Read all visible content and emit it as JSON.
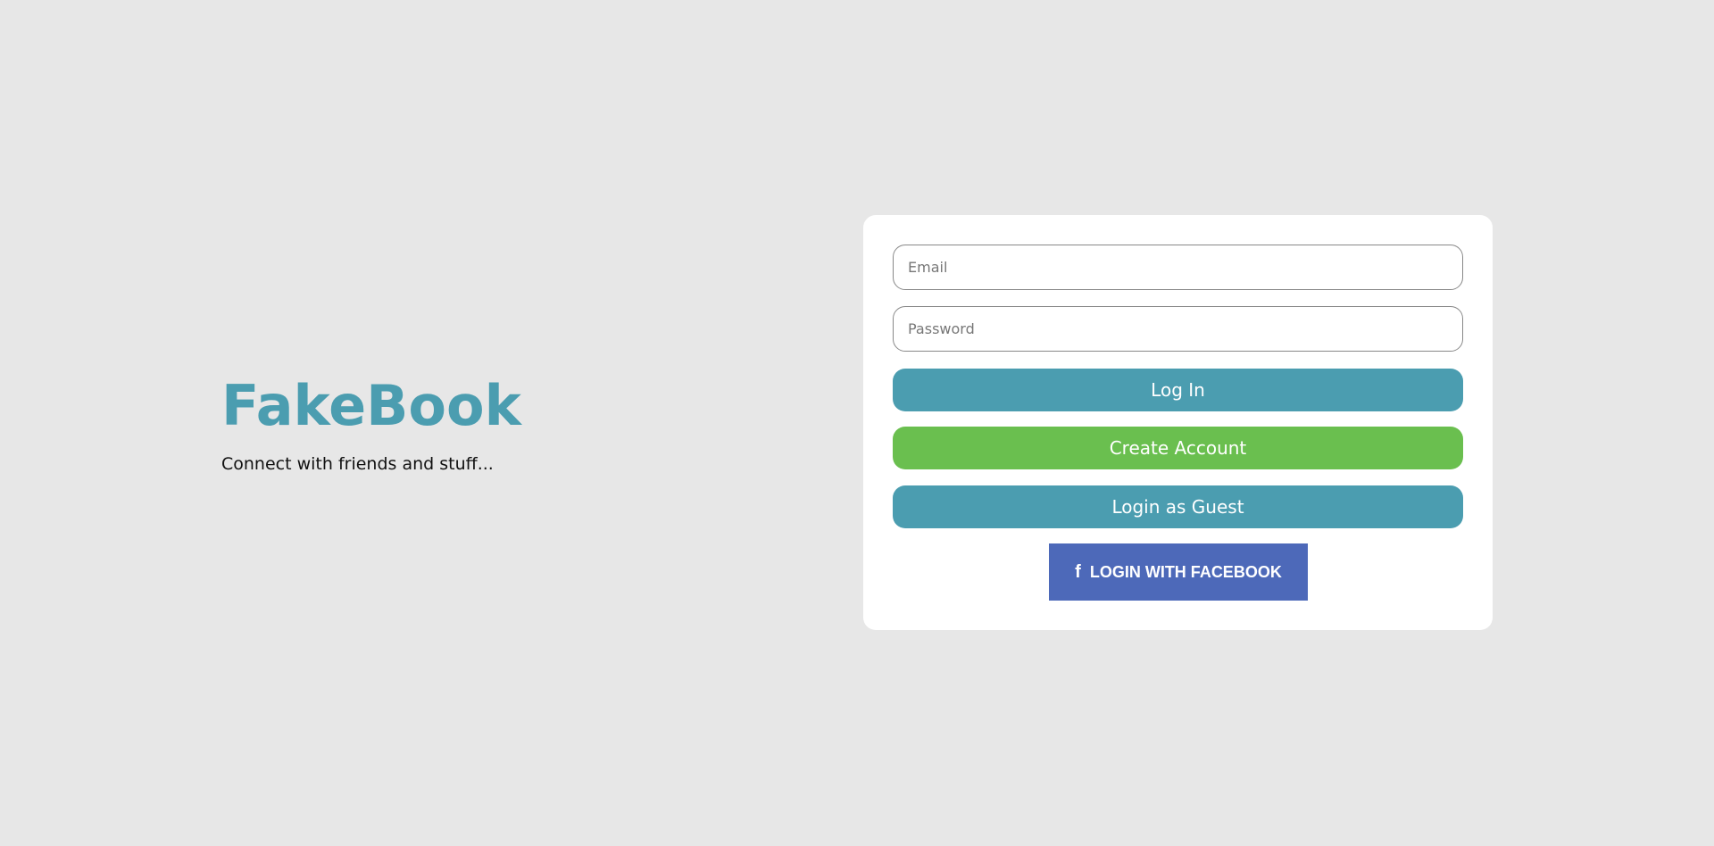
{
  "brand": {
    "title": "FakeBook",
    "tagline": "Connect with friends and stuff..."
  },
  "login_form": {
    "email_placeholder": "Email",
    "password_placeholder": "Password",
    "login_label": "Log In",
    "create_account_label": "Create Account",
    "guest_label": "Login as Guest",
    "facebook_label": "LOGIN WITH FACEBOOK",
    "facebook_icon": "f"
  },
  "colors": {
    "brand": "#4b9db0",
    "create": "#6abf4f",
    "facebook": "#4d69b9",
    "background": "#e7e7e7"
  }
}
